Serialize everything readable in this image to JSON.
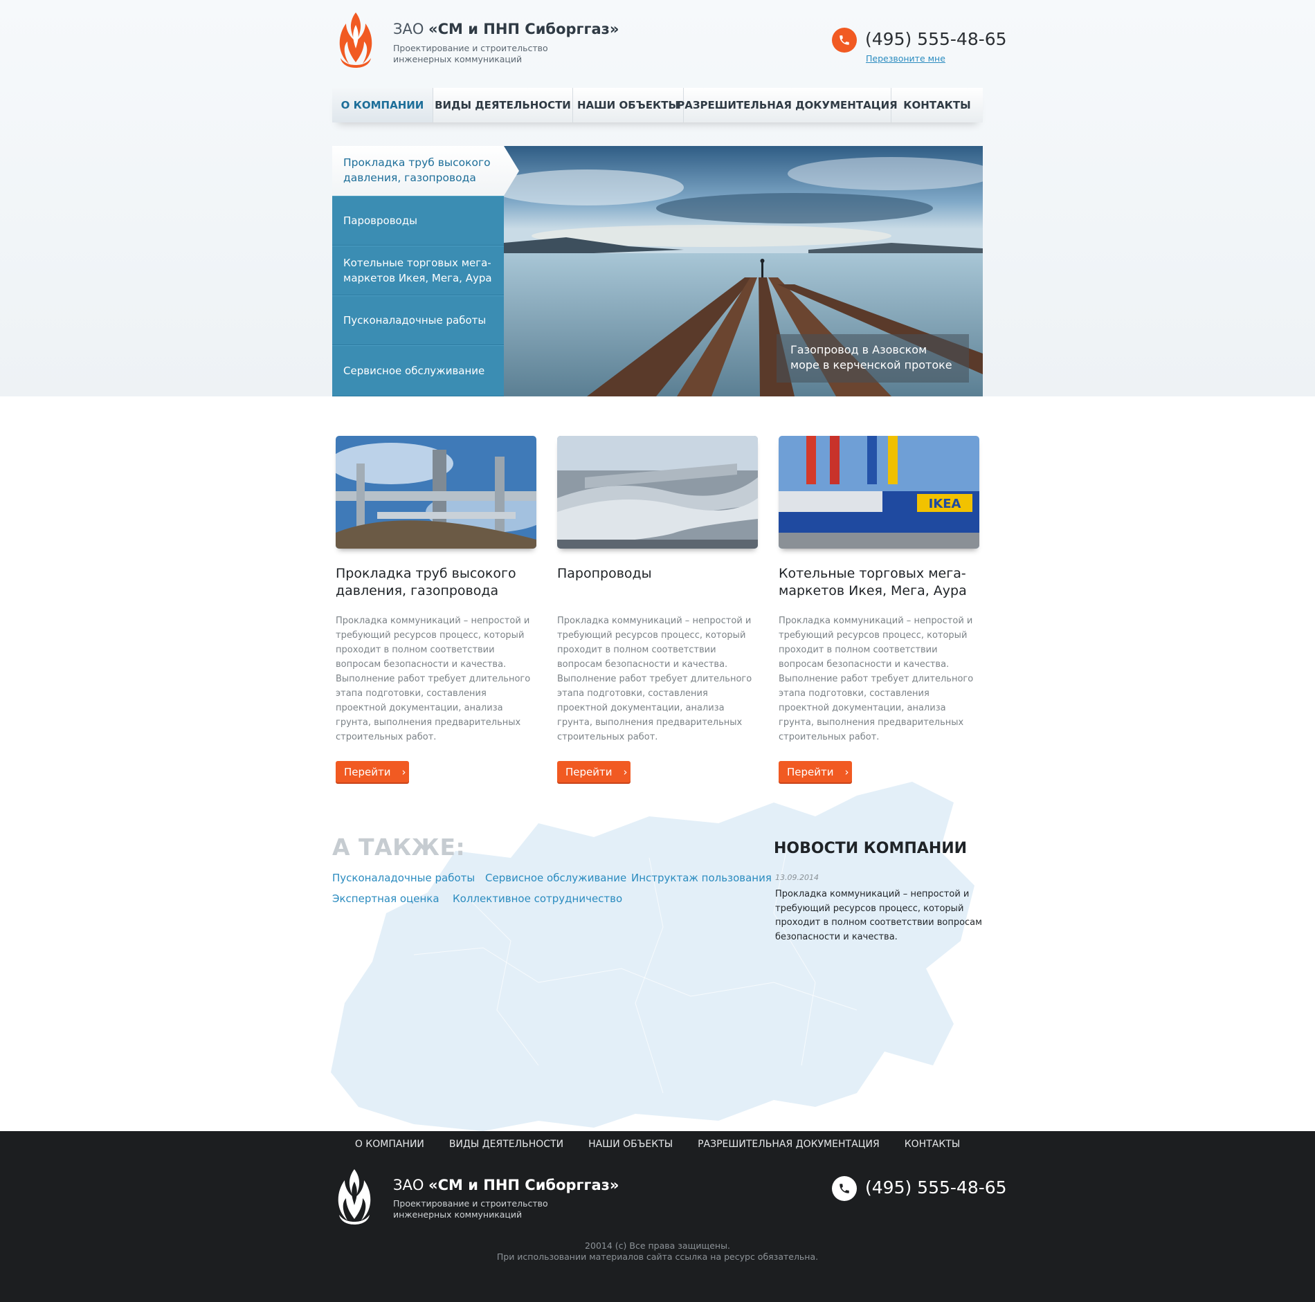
{
  "header": {
    "company_prefix": "ЗАО",
    "company_name": "«СМ и ПНП Сиборггаз»",
    "subtitle": "Проектирование и строительство инженерных коммуникаций",
    "phone": "(495) 555-48-65",
    "callback_label": "Перезвоните мне"
  },
  "nav": {
    "items": [
      {
        "label": "О КОМПАНИИ",
        "active": true
      },
      {
        "label": "ВИДЫ ДЕЯТЕЛЬНОСТИ",
        "active": false
      },
      {
        "label": "НАШИ ОБЪЕКТЫ",
        "active": false
      },
      {
        "label": "РАЗРЕШИТЕЛЬНАЯ ДОКУМЕНТАЦИЯ",
        "active": false
      },
      {
        "label": "КОНТАКТЫ",
        "active": false
      }
    ]
  },
  "slider": {
    "items": [
      {
        "label": "Прокладка труб высокого давления, газопровода"
      },
      {
        "label": "Паровроводы"
      },
      {
        "label": "Котельные торговых мега-маркетов Икея, Мега, Аура"
      },
      {
        "label": "Пусконаладочные работы"
      },
      {
        "label": "Сервисное обслуживание"
      }
    ],
    "caption": "Газопровод в Азовском море в керченской протоке"
  },
  "cards": [
    {
      "title": "Прокладка труб высокого давления, газопровода",
      "text": "Прокладка коммуникаций – непростой и требующий ресурсов процесс, который проходит в полном соответствии вопросам безопасности и качества. Выполнение работ требует длительного этапа подготовки, составления проектной документации, анализа грунта, выполнения предварительных строительных работ.",
      "button": "Перейти"
    },
    {
      "title": "Паропроводы",
      "text": "Прокладка коммуникаций – непростой и требующий ресурсов процесс, который проходит в полном соответствии вопросам безопасности и качества. Выполнение работ требует длительного этапа подготовки, составления проектной документации, анализа грунта, выполнения предварительных строительных работ.",
      "button": "Перейти"
    },
    {
      "title": "Котельные торговых мега-маркетов Икея, Мега, Аура",
      "text": "Прокладка коммуникаций – непростой и требующий ресурсов процесс, который проходит в полном соответствии вопросам безопасности и качества. Выполнение работ требует длительного этапа подготовки, составления проектной документации, анализа грунта, выполнения предварительных строительных работ.",
      "button": "Перейти",
      "sign": "IKEA"
    }
  ],
  "also": {
    "title": "А ТАКЖЕ:",
    "links": [
      "Пусконаладочные работы",
      "Сервисное обслуживание",
      "Инструктаж пользования",
      "Экспертная оценка",
      "Коллективное сотрудничество"
    ]
  },
  "news": {
    "title": "НОВОСТИ КОМПАНИИ",
    "date": "13.09.2014",
    "text": "Прокладка коммуникаций – непростой и требующий ресурсов процесс, который проходит в полном соответствии вопросам безопасности и качества."
  },
  "footer": {
    "nav": [
      "О КОМПАНИИ",
      "ВИДЫ ДЕЯТЕЛЬНОСТИ",
      "НАШИ ОБЪЕКТЫ",
      "РАЗРЕШИТЕЛЬНАЯ ДОКУМЕНТАЦИЯ",
      "КОНТАКТЫ"
    ],
    "company_prefix": "ЗАО",
    "company_name": "«СМ и ПНП Сиборггаз»",
    "subtitle": "Проектирование и строительство инженерных коммуникаций",
    "phone": "(495) 555-48-65",
    "copyright": "20014 (c) Все права защищены.",
    "notice": "При использовании материалов сайта ссылка на ресурс обязательна."
  },
  "colors": {
    "accent": "#f15a22",
    "primary_blue": "#3b8db3",
    "link_blue": "#2a8bbf",
    "footer_bg": "#1c1e20"
  },
  "icons": {
    "logo": "flame-logo-icon",
    "phone": "phone-icon",
    "button_arrow": "chevron-right-icon"
  }
}
